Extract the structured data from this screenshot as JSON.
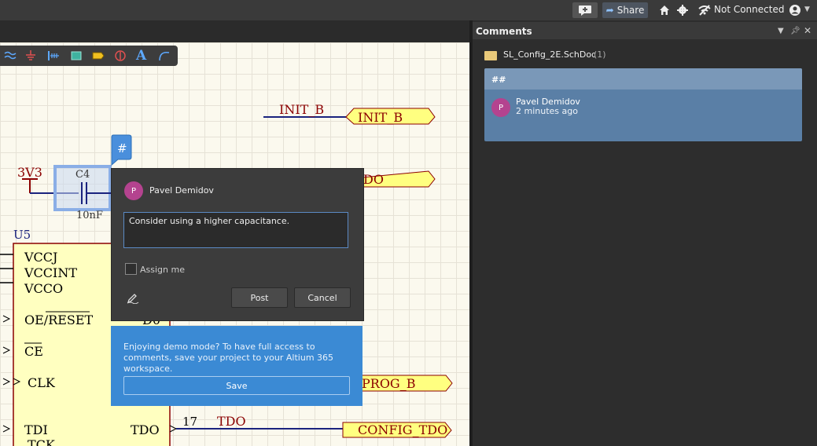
{
  "topbar": {
    "share_label": "Share",
    "connection_status": "Not Connected"
  },
  "schematic": {
    "labels": {
      "init_net": "INIT_B",
      "init_port": "INIT_B",
      "power": "3V3",
      "cap_ref": "C4",
      "cap_value": "10nF",
      "do_port_partial": "DO",
      "u5": "U5",
      "pin_vccj": "VCCJ",
      "pin_vccint": "VCCINT",
      "pin_vcco": "VCCO",
      "pin_oe_reset": "OE/RESET",
      "pin_d0": "D0",
      "pin_ce": "CE",
      "pin_clk": "CLK",
      "pin_tdi": "TDI",
      "pin_tdo": "TDO",
      "pin_tck_partial": "TCK",
      "pin_number_17": "17",
      "tdo_net": "TDO",
      "prog_port": "PROG_B",
      "config_tdo_port": "CONFIG_TDO"
    },
    "comment_marker": "#"
  },
  "popup": {
    "avatar_letter": "P",
    "author": "Pavel Demidov",
    "comment_text": "Consider using a higher capacitance.",
    "assign_label": "Assign me",
    "post_label": "Post",
    "cancel_label": "Cancel"
  },
  "demo_banner": {
    "message": "Enjoying demo mode? To have full access to comments, save your project to your Altium 365 workspace.",
    "save_label": "Save"
  },
  "comments_panel": {
    "title": "Comments",
    "document_name": "SL_Config_2E.SchDoc",
    "document_count": "(1)",
    "thread": {
      "tag": "##",
      "avatar_letter": "P",
      "author": "Pavel Demidov",
      "time": "2 minutes ago"
    }
  },
  "colors": {
    "accent": "#3b8ad4",
    "avatar": "#b4438f",
    "net_wire": "#1a237e",
    "net_label": "#8b0000",
    "port_fill": "#ffff80",
    "component_fill": "#ffffc0"
  },
  "icons": [
    "add-comment-icon",
    "share-arrow-icon",
    "home-icon",
    "gear-icon",
    "not-connected-icon",
    "user-icon",
    "pen-icon",
    "document-icon"
  ]
}
